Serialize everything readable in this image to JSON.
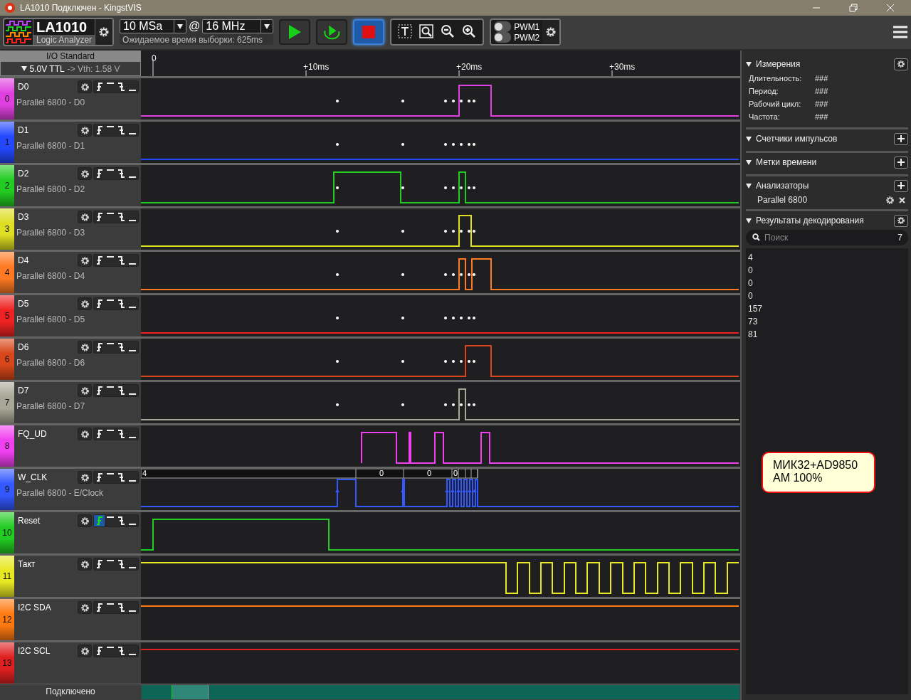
{
  "window": {
    "title": "LA1010 Подключен - KingstVIS"
  },
  "toolbar": {
    "device": "LA1010",
    "device_subtitle": "Logic Analyzer",
    "sample_depth": "10 MSa",
    "at": "@",
    "sample_rate": "16 MHz",
    "expected_time": "Ожидаемое время выборки: 625ms",
    "stop_active": true,
    "pwm": [
      {
        "label": "PWM1",
        "on": false
      },
      {
        "label": "PWM2",
        "on": false
      }
    ]
  },
  "io_standard": {
    "title": "I/O Standard",
    "level": "5.0V TTL",
    "threshold": "-> Vth: 1.58 V"
  },
  "timeline": [
    "0",
    "+10ms",
    "+20ms",
    "+30ms"
  ],
  "channels": [
    {
      "number": "0",
      "name": "D0",
      "subtitle": "Parallel 6800 - D0",
      "color": "#e040e0",
      "rising_trigger": false
    },
    {
      "number": "1",
      "name": "D1",
      "subtitle": "Parallel 6800 - D1",
      "color": "#2448ff",
      "rising_trigger": false
    },
    {
      "number": "2",
      "name": "D2",
      "subtitle": "Parallel 6800 - D2",
      "color": "#22cc22",
      "rising_trigger": false
    },
    {
      "number": "3",
      "name": "D3",
      "subtitle": "Parallel 6800 - D3",
      "color": "#dede22",
      "rising_trigger": false
    },
    {
      "number": "4",
      "name": "D4",
      "subtitle": "Parallel 6800 - D4",
      "color": "#ff7a22",
      "rising_trigger": false
    },
    {
      "number": "5",
      "name": "D5",
      "subtitle": "Parallel 6800 - D5",
      "color": "#ee2222",
      "rising_trigger": false
    },
    {
      "number": "6",
      "name": "D6",
      "subtitle": "Parallel 6800 - D6",
      "color": "#d8461a",
      "rising_trigger": false
    },
    {
      "number": "7",
      "name": "D7",
      "subtitle": "Parallel 6800 - D7",
      "color": "#a8a898",
      "rising_trigger": false
    },
    {
      "number": "8",
      "name": "FQ_UD",
      "color": "#f040f0",
      "rising_trigger": false
    },
    {
      "number": "9",
      "name": "W_CLK",
      "subtitle": "Parallel 6800 - E/Clock",
      "color": "#3358ff",
      "rising_trigger": false,
      "bus_values": [
        "4",
        "0",
        "0",
        "0"
      ]
    },
    {
      "number": "10",
      "name": "Reset",
      "color": "#22cc22",
      "rising_trigger": true
    },
    {
      "number": "11",
      "name": "Такт",
      "color": "#e8e822",
      "rising_trigger": false
    },
    {
      "number": "12",
      "name": "I2C SDA",
      "color": "#ff7a10",
      "rising_trigger": false
    },
    {
      "number": "13",
      "name": "I2C SCL",
      "color": "#e02020",
      "rising_trigger": false
    }
  ],
  "note": "МИК32+AD9850\nAM 100%",
  "status_bar": "Подключено",
  "panel": {
    "measurements": {
      "title": "Измерения",
      "rows": [
        {
          "label": "Длительность:",
          "value": "###"
        },
        {
          "label": "Период:",
          "value": "###"
        },
        {
          "label": "Рабочий цикл:",
          "value": "###"
        },
        {
          "label": "Частота:",
          "value": "###"
        }
      ]
    },
    "pulse_counters": {
      "title": "Счетчики импульсов"
    },
    "timestamps": {
      "title": "Метки времени"
    },
    "analyzers": {
      "title": "Анализаторы",
      "items": [
        "Parallel 6800"
      ]
    },
    "decode": {
      "title": "Результаты декодирования",
      "placeholder": "Поиск",
      "count": "7",
      "results": [
        "4",
        "0",
        "0",
        "0",
        "157",
        "73",
        "81"
      ]
    }
  }
}
